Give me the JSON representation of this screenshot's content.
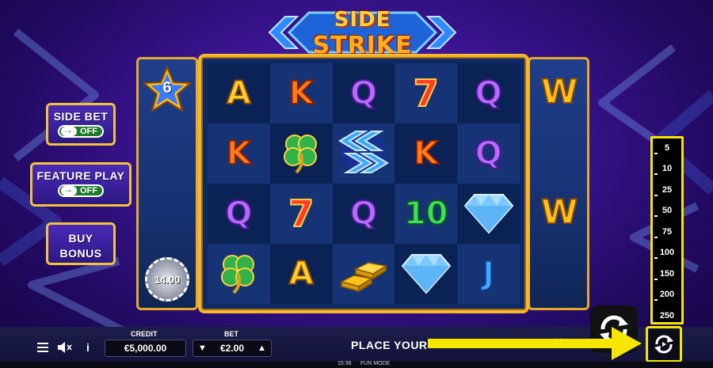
{
  "game": {
    "logo_line1": "SIDE",
    "logo_line2": "STRIKE"
  },
  "reels": {
    "columns": [
      [
        "A",
        "K",
        "Q",
        "clover-icon"
      ],
      [
        "K",
        "clover-icon",
        "7",
        "A"
      ],
      [
        "Q",
        "chevron-wild-icon",
        "Q",
        "gold-bars-icon"
      ],
      [
        "7",
        "K",
        "10",
        "diamond-icon"
      ],
      [
        "Q",
        "Q",
        "diamond-icon",
        "J"
      ]
    ],
    "left_reel_star_value": "6",
    "left_reel_chip_value": "14.00",
    "right_reel_symbols": [
      "W",
      "W"
    ]
  },
  "buttons": {
    "side_bet_label": "SIDE BET",
    "side_bet_state": "OFF",
    "feature_play_label": "FEATURE PLAY",
    "feature_play_state": "OFF",
    "buy_bonus_line1": "BUY",
    "buy_bonus_line2": "BONUS"
  },
  "autoplay_options": [
    "5",
    "10",
    "25",
    "50",
    "75",
    "100",
    "150",
    "200",
    "250"
  ],
  "bottom_bar": {
    "credit_label": "CREDIT",
    "credit_value": "€5,000.00",
    "bet_label": "BET",
    "bet_value": "€2.00",
    "message": "PLACE YOUR",
    "info_icon": "i"
  },
  "footer": {
    "time": "15:38",
    "mode": "FUN MODE"
  },
  "colors": {
    "highlight": "#f7e600",
    "frame_gold": "#f3b830",
    "button_purple": "#4a2ab8"
  }
}
